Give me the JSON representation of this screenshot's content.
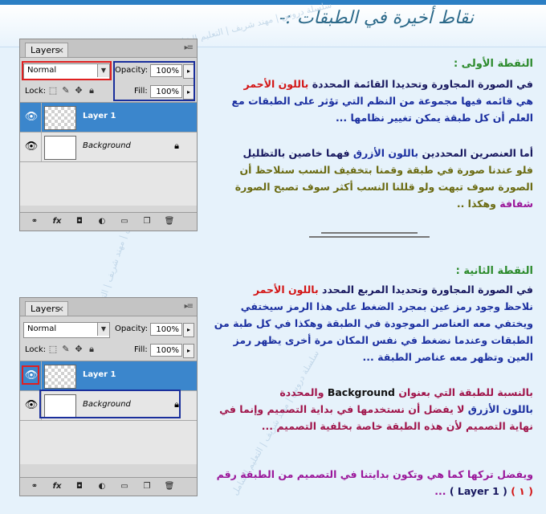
{
  "heading": "نقاط أخيرة في الطبقات :-",
  "watermark": "سلسلة دروس | مهند شريف | التعليم الشامل",
  "panel": {
    "tab_label": "Layers",
    "tab_close": "×",
    "blend_mode": "Normal",
    "opacity_label": "Opacity:",
    "opacity_value": "100%",
    "lock_label": "Lock:",
    "fill_label": "Fill:",
    "fill_value": "100%",
    "layers": [
      {
        "name": "Layer 1"
      },
      {
        "name": "Background"
      }
    ]
  },
  "colors": {
    "selected_layer": "#3b86cc",
    "highlight_red": "#e02020",
    "highlight_blue": "#1a2f9c"
  },
  "icons": [
    "eye-icon",
    "lock-icon",
    "link-icon",
    "fx-icon",
    "mask-icon",
    "adjustment-icon",
    "folder-icon",
    "new-layer-icon",
    "trash-icon"
  ],
  "point1": {
    "title": "النقطة الأولى :",
    "p1a": "في الصورة المجاورة وتحديدا القائمة المحددة ",
    "p1b": "باللون الأحمر",
    "p1c": "هي قائمه فيها مجموعة من النظم التي تؤثر على الطبقات مع العلم أن كل طبقة يمكن تغيير نظامها ...",
    "p2a": "أما العنصرين المحددين ",
    "p2b": "باللون الأزرق",
    "p2c": " فهما خاصين بالتظليل",
    "p2d": "فلو عندنا صورة في طبقة وقمنا بتخفيف النسب سنلاحظ أن الصورة سوف تبهت ولو قللنا النسب أكثر سوف تصبح الصورة ",
    "p2e": "شفافة",
    "p2f": " وهكذا .."
  },
  "point2": {
    "title": "النقطة الثانية :",
    "p1a": "في الصورة المجاورة وتحديدا المربع المحدد ",
    "p1b": "باللون الأحمر",
    "p1c": "نلاحظ وجود رمز عين بمجرد الضغط على هذا الرمز سيختفي ويختفي معه العناصر الموجودة في الطبقة وهكذا في كل طبة من الطبقات وعندما نضغط في نفس المكان مرة أخرى يظهر رمز العين وتظهر معه عناصر الطبقة ...",
    "p2a": "بالنسبة للطبقة التي بعنوان ",
    "p2b": "Background",
    "p2c": " والمحددة",
    "p2d": "باللون الأزرق",
    "p2e": " لا يفضل أن نستخدمها في بداية التصميم وإنما في نهاية التصميم لأن هذه الطبقة خاصة بخلفية التصميم ...",
    "p3a": "ويفضل تركها كما هي وتكون بدايتنا في التصميم من الطبقة رقم",
    "p3b": "( ١ )",
    "p3c": "( Layer 1 )",
    "p3d": "..."
  }
}
